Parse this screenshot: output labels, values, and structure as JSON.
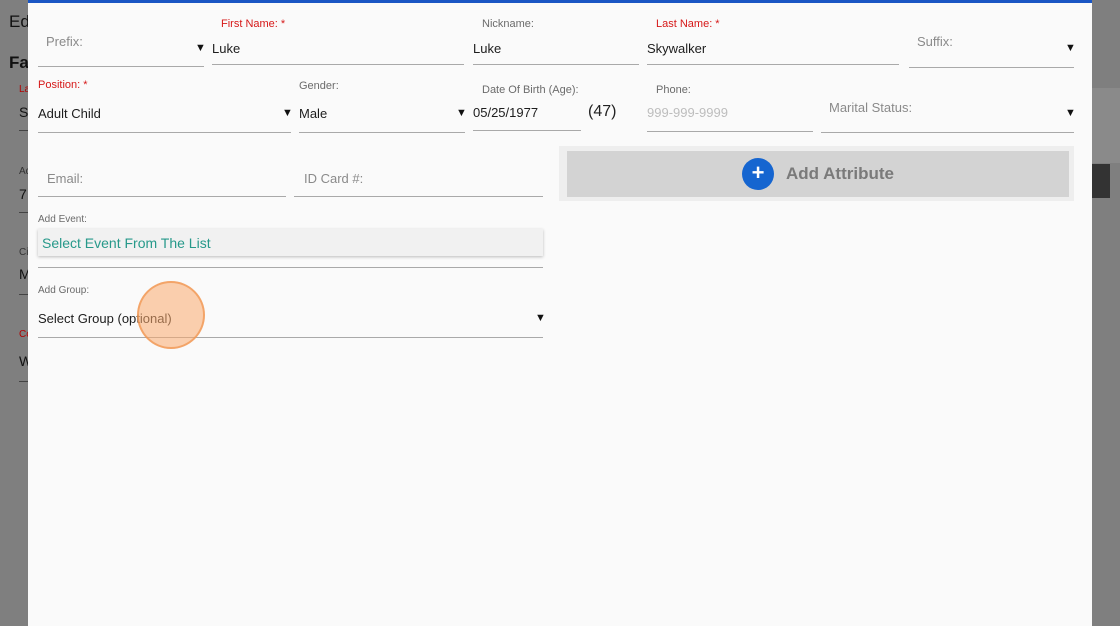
{
  "background": {
    "title_fragment": "Ed",
    "section_fragment": "Fa",
    "frag_la": "La",
    "frag_s": "S",
    "frag_ad": "Ad",
    "frag_7": "7",
    "frag_ci": "Ci",
    "frag_m": "M",
    "frag_co": "Co",
    "frag_w": "W"
  },
  "form": {
    "prefix": {
      "label": "Prefix:",
      "value": ""
    },
    "first_name": {
      "label": "First Name: *",
      "value": "Luke"
    },
    "nickname": {
      "label": "Nickname:",
      "value": "Luke"
    },
    "last_name": {
      "label": "Last Name: *",
      "value": "Skywalker"
    },
    "suffix": {
      "label": "Suffix:",
      "value": ""
    },
    "position": {
      "label": "Position: *",
      "value": "Adult Child"
    },
    "gender": {
      "label": "Gender:",
      "value": "Male"
    },
    "dob": {
      "label": "Date Of Birth (Age):",
      "value": "05/25/1977",
      "age": "(47)"
    },
    "phone": {
      "label": "Phone:",
      "placeholder": "999-999-9999"
    },
    "marital_status": {
      "label": "Marital Status:",
      "value": ""
    },
    "email": {
      "label": "Email:"
    },
    "id_card": {
      "label": "ID Card #:"
    },
    "add_attribute": {
      "icon": "plus-icon",
      "label": "Add Attribute"
    },
    "add_event": {
      "label": "Add Event:",
      "value": "Select Event From The List"
    },
    "add_group": {
      "label": "Add Group:",
      "value": "Select Group (optional)"
    },
    "caret": "▼"
  },
  "colors": {
    "accent": "#1a56c4",
    "required": "#d61818",
    "event_text": "#27998a",
    "attr_icon": "#1565d0"
  }
}
